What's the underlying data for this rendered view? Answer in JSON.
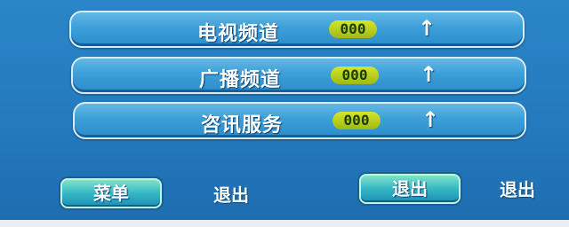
{
  "channels": [
    {
      "label": "电视频道",
      "count": "000",
      "arrow": "↑"
    },
    {
      "label": "广播频道",
      "count": "000",
      "arrow": "↑"
    },
    {
      "label": "咨讯服务",
      "count": "000",
      "arrow": "↑"
    }
  ],
  "footer": {
    "menu_button": "菜单",
    "menu_hint": "退出",
    "exit_button": "退出",
    "exit_hint": "退出"
  },
  "colors": {
    "background": "#2479bd",
    "row": "#3d9fd8",
    "count_badge": "#c3d61f",
    "button": "#35b7c4"
  }
}
